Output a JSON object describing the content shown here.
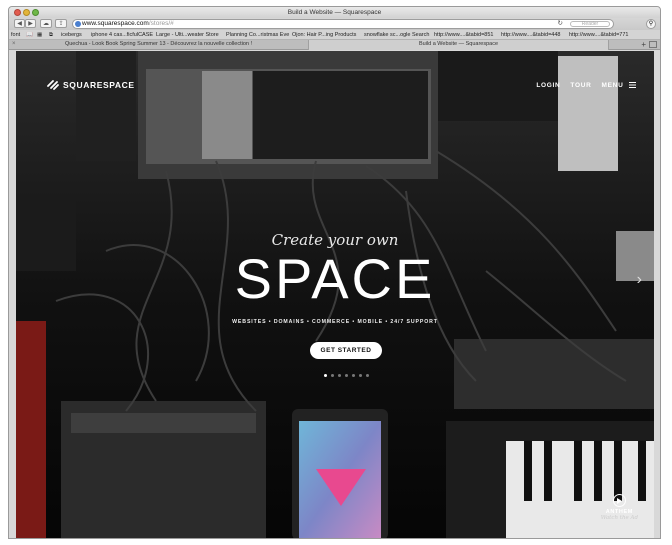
{
  "browser": {
    "window_title": "Build a Website — Squarespace",
    "url_domain": "www.squarespace.com",
    "url_path": "/stores/#",
    "reader_label": "Reader",
    "bookmarks": [
      "font",
      "icebergs",
      "iphone 4 cas...ficfulCASE",
      "Large - Ulti...weater Store",
      "Planning Co...ristmas Eve",
      "Ojon: Hair P...ing Products",
      "snowflake sc...ogle Search",
      "http://www....&tabid=851",
      "http://www....&tabid=448",
      "http://www....&tabid=771"
    ],
    "tabs": [
      {
        "label": "Quechua - Look Book Spring Summer 13 - Découvrez la nouvelle collection !",
        "active": false
      },
      {
        "label": "Build a Website — Squarespace",
        "active": true
      }
    ]
  },
  "site": {
    "logo_text": "SQUARESPACE",
    "nav": {
      "login": "LOGIN",
      "tour": "TOUR",
      "menu": "MENU"
    },
    "hero": {
      "tagline": "Create your own",
      "title": "SPACE",
      "subtitle": "WEBSITES • DOMAINS • COMMERCE • MOBILE • 24/7 SUPPORT",
      "cta": "GET STARTED"
    },
    "carousel": {
      "count": 7,
      "active_index": 0
    },
    "anthem": {
      "label": "ANTHEM",
      "sub": "Watch the Ad"
    },
    "accent": "#e8498f"
  }
}
